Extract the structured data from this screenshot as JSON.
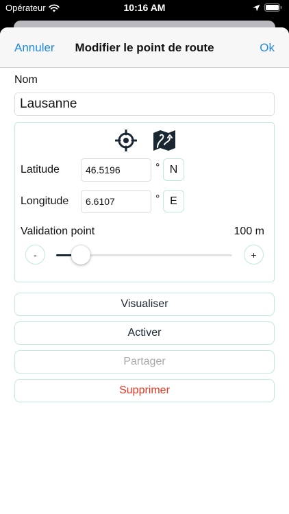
{
  "status_bar": {
    "carrier": "Opérateur",
    "time": "10:16 AM",
    "icons": [
      "wifi-icon",
      "location-arrow-icon",
      "battery-icon"
    ]
  },
  "navbar": {
    "cancel_label": "Annuler",
    "title": "Modifier le point de route",
    "ok_label": "Ok"
  },
  "name": {
    "label": "Nom",
    "value": "Lausanne"
  },
  "coordinates": {
    "icons": [
      "crosshair-target-icon",
      "map-icon"
    ],
    "latitude": {
      "label": "Latitude",
      "value": "46.5196",
      "degree_symbol": "°",
      "hemisphere": "N"
    },
    "longitude": {
      "label": "Longitude",
      "value": "6.6107",
      "degree_symbol": "°",
      "hemisphere": "E"
    }
  },
  "validation": {
    "label": "Validation point",
    "value_text": "100 m",
    "decrement_label": "-",
    "increment_label": "+",
    "slider_fraction": 0.14
  },
  "actions": {
    "visualize_label": "Visualiser",
    "activate_label": "Activer",
    "share_label": "Partager",
    "delete_label": "Supprimer"
  },
  "colors": {
    "accent_blue": "#1f8ae0",
    "border_mint": "#bfe8de",
    "delete_red": "#e8351f",
    "disabled_gray": "#a8a8a8",
    "icon_navy": "#1a2733"
  }
}
